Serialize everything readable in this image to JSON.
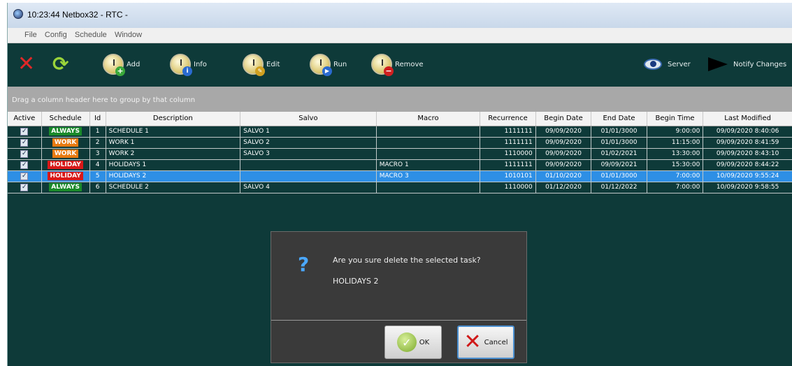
{
  "window": {
    "title": "10:23:44  Netbox32  -  RTC  -"
  },
  "menu": [
    "File",
    "Config",
    "Schedule",
    "Window"
  ],
  "toolbar": {
    "add": "Add",
    "info": "Info",
    "edit": "Edit",
    "run": "Run",
    "remove": "Remove",
    "server": "Server",
    "notify": "Notify Changes"
  },
  "group_hint": "Drag a column header here to group by that column",
  "columns": [
    "Active",
    "Schedule",
    "Id",
    "Description",
    "Salvo",
    "Macro",
    "Recurrence",
    "Begin Date",
    "End Date",
    "Begin Time",
    "Last Modified"
  ],
  "rows": [
    {
      "active": "✓",
      "schedule": "ALWAYS",
      "id": "1",
      "description": "SCHEDULE 1",
      "salvo": "SALVO 1",
      "macro": "",
      "recurrence": "1111111",
      "begin_date": "09/09/2020",
      "end_date": "01/01/3000",
      "begin_time": "9:00:00",
      "last_modified": "09/09/2020 8:40:06"
    },
    {
      "active": "✓",
      "schedule": "WORK",
      "id": "2",
      "description": "WORK 1",
      "salvo": "SALVO 2",
      "macro": "",
      "recurrence": "1111111",
      "begin_date": "09/09/2020",
      "end_date": "01/01/3000",
      "begin_time": "11:15:00",
      "last_modified": "09/09/2020 8:41:59"
    },
    {
      "active": "✓",
      "schedule": "WORK",
      "id": "3",
      "description": "WORK 2",
      "salvo": "SALVO 3",
      "macro": "",
      "recurrence": "1110000",
      "begin_date": "09/09/2020",
      "end_date": "01/02/2021",
      "begin_time": "13:30:00",
      "last_modified": "09/09/2020 8:43:10"
    },
    {
      "active": "✓",
      "schedule": "HOLIDAY",
      "id": "4",
      "description": "HOLIDAYS 1",
      "salvo": "",
      "macro": "MACRO 1",
      "recurrence": "1111111",
      "begin_date": "09/09/2020",
      "end_date": "09/09/2021",
      "begin_time": "15:30:00",
      "last_modified": "09/09/2020 8:44:22"
    },
    {
      "active": "✓",
      "schedule": "HOLIDAY",
      "id": "5",
      "description": "HOLIDAYS 2",
      "salvo": "",
      "macro": "MACRO 3",
      "recurrence": "1010101",
      "begin_date": "01/10/2020",
      "end_date": "01/01/3000",
      "begin_time": "7:00:00",
      "last_modified": "10/09/2020 9:55:24",
      "selected": true
    },
    {
      "active": "✓",
      "schedule": "ALWAYS",
      "id": "6",
      "description": "SCHEDULE 2",
      "salvo": "SALVO 4",
      "macro": "",
      "recurrence": "1110000",
      "begin_date": "01/12/2020",
      "end_date": "01/12/2022",
      "begin_time": "7:00:00",
      "last_modified": "10/09/2020 9:58:55"
    }
  ],
  "schedule_colors": {
    "ALWAYS": "#1a8a2a",
    "WORK": "#e87a10",
    "HOLIDAY": "#d81818"
  },
  "dialog": {
    "icon": "question-icon",
    "message": "Are you sure delete the selected task?",
    "item": "HOLIDAYS 2",
    "ok": "OK",
    "cancel": "Cancel"
  }
}
